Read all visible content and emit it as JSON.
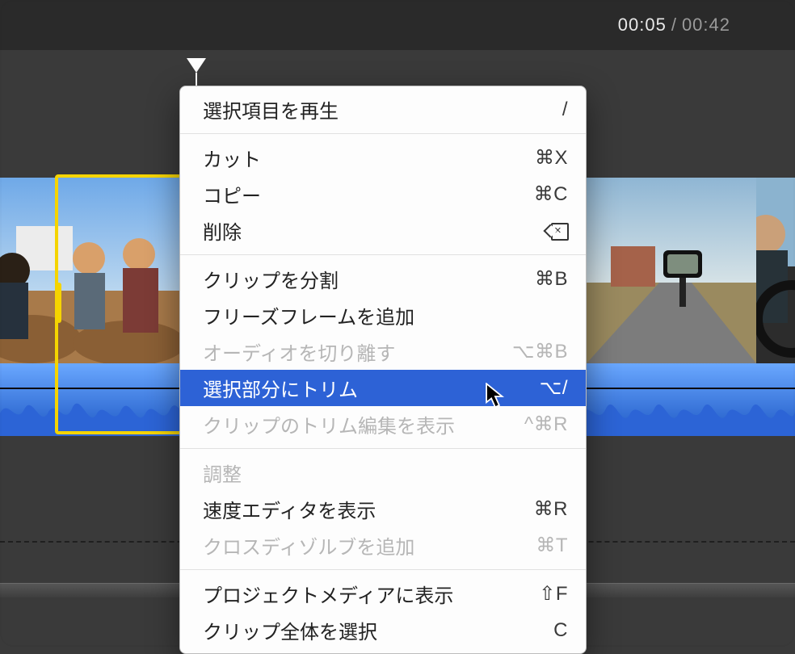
{
  "time": {
    "current": "00:05",
    "separator": "/",
    "total": "00:42"
  },
  "menu": {
    "play_selection": {
      "label": "選択項目を再生",
      "shortcut": "/"
    },
    "cut": {
      "label": "カット",
      "shortcut": "⌘X"
    },
    "copy": {
      "label": "コピー",
      "shortcut": "⌘C"
    },
    "delete": {
      "label": "削除"
    },
    "split_clip": {
      "label": "クリップを分割",
      "shortcut": "⌘B"
    },
    "add_freeze": {
      "label": "フリーズフレームを追加"
    },
    "detach_audio": {
      "label": "オーディオを切り離す",
      "shortcut": "⌥⌘B"
    },
    "trim_to_sel": {
      "label": "選択部分にトリム",
      "shortcut": "⌥/"
    },
    "show_trim_edit": {
      "label": "クリップのトリム編集を表示",
      "shortcut": "^⌘R"
    },
    "adjust": {
      "label": "調整"
    },
    "show_speed": {
      "label": "速度エディタを表示",
      "shortcut": "⌘R"
    },
    "add_crossdis": {
      "label": "クロスディゾルブを追加",
      "shortcut": "⌘T"
    },
    "reveal_media": {
      "label": "プロジェクトメディアに表示",
      "shortcut": "⇧F"
    },
    "select_entire": {
      "label": "クリップ全体を選択",
      "shortcut": "C"
    }
  }
}
